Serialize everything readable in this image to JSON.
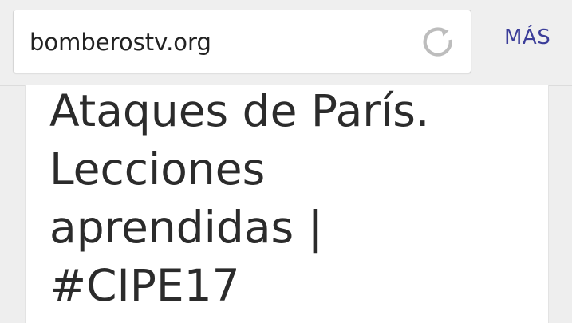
{
  "browser": {
    "url": "bomberostv.org",
    "more_label": "MÁS",
    "reload_icon": "reload-icon"
  },
  "article": {
    "title_lines": [
      "Ataques de París.",
      "Lecciones",
      "aprendidas |",
      "#CIPE17"
    ]
  },
  "colors": {
    "accent": "#3b3d99",
    "toolbar_bg": "#efefef",
    "text": "#2b2b2b"
  }
}
